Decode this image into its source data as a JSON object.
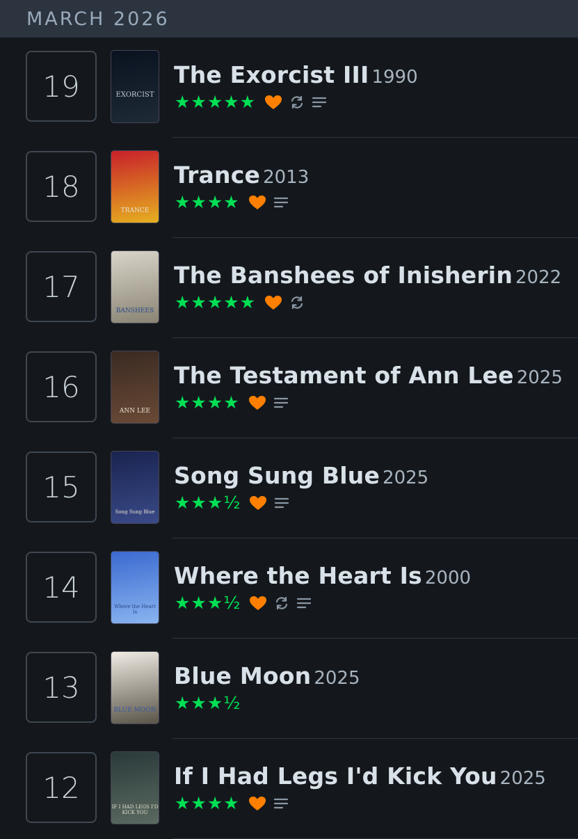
{
  "header": {
    "month": "MARCH 2026"
  },
  "entries": [
    {
      "day": "19",
      "title": "The Exorcist III",
      "year": "1990",
      "stars": "★★★★★",
      "liked": true,
      "rewatch": true,
      "review": true,
      "poster_text": "EXORCIST",
      "poster_colors": [
        "#0a1220",
        "#1e2a36"
      ]
    },
    {
      "day": "18",
      "title": "Trance",
      "year": "2013",
      "stars": "★★★★",
      "liked": true,
      "rewatch": false,
      "review": true,
      "poster_text": "TRANCE",
      "poster_colors": [
        "#c8202a",
        "#e6b020"
      ]
    },
    {
      "day": "17",
      "title": "The Banshees of Inisherin",
      "year": "2022",
      "stars": "★★★★★",
      "liked": true,
      "rewatch": true,
      "review": false,
      "poster_text": "BANSHEES",
      "poster_colors": [
        "#d8d4c8",
        "#8a8474"
      ]
    },
    {
      "day": "16",
      "title": "The Testament of Ann Lee",
      "year": "2025",
      "stars": "★★★★",
      "liked": true,
      "rewatch": false,
      "review": true,
      "poster_text": "ANN LEE",
      "poster_colors": [
        "#3a2a22",
        "#6a4a36"
      ]
    },
    {
      "day": "15",
      "title": "Song Sung Blue",
      "year": "2025",
      "stars": "★★★½",
      "liked": true,
      "rewatch": false,
      "review": true,
      "poster_text": "Song Sung Blue",
      "poster_colors": [
        "#1a2450",
        "#3a4a88"
      ]
    },
    {
      "day": "14",
      "title": "Where the Heart Is",
      "year": "2000",
      "stars": "★★★½",
      "liked": true,
      "rewatch": true,
      "review": true,
      "poster_text": "Where the Heart Is",
      "poster_colors": [
        "#3a6ad0",
        "#8ab4f0"
      ]
    },
    {
      "day": "13",
      "title": "Blue Moon",
      "year": "2025",
      "stars": "★★★½",
      "liked": false,
      "rewatch": false,
      "review": false,
      "poster_text": "BLUE MOON",
      "poster_colors": [
        "#f0ece4",
        "#5a5448"
      ]
    },
    {
      "day": "12",
      "title": "If I Had Legs I'd Kick You",
      "year": "2025",
      "stars": "★★★★",
      "liked": true,
      "rewatch": false,
      "review": true,
      "poster_text": "IF I HAD LEGS I'D KICK YOU",
      "poster_colors": [
        "#2a3a3a",
        "#5a6a60"
      ]
    }
  ],
  "colors": {
    "star": "#00e054",
    "heart": "#ff8000",
    "icon": "#8a97a4",
    "background": "#14181c",
    "header": "#2c3440"
  }
}
